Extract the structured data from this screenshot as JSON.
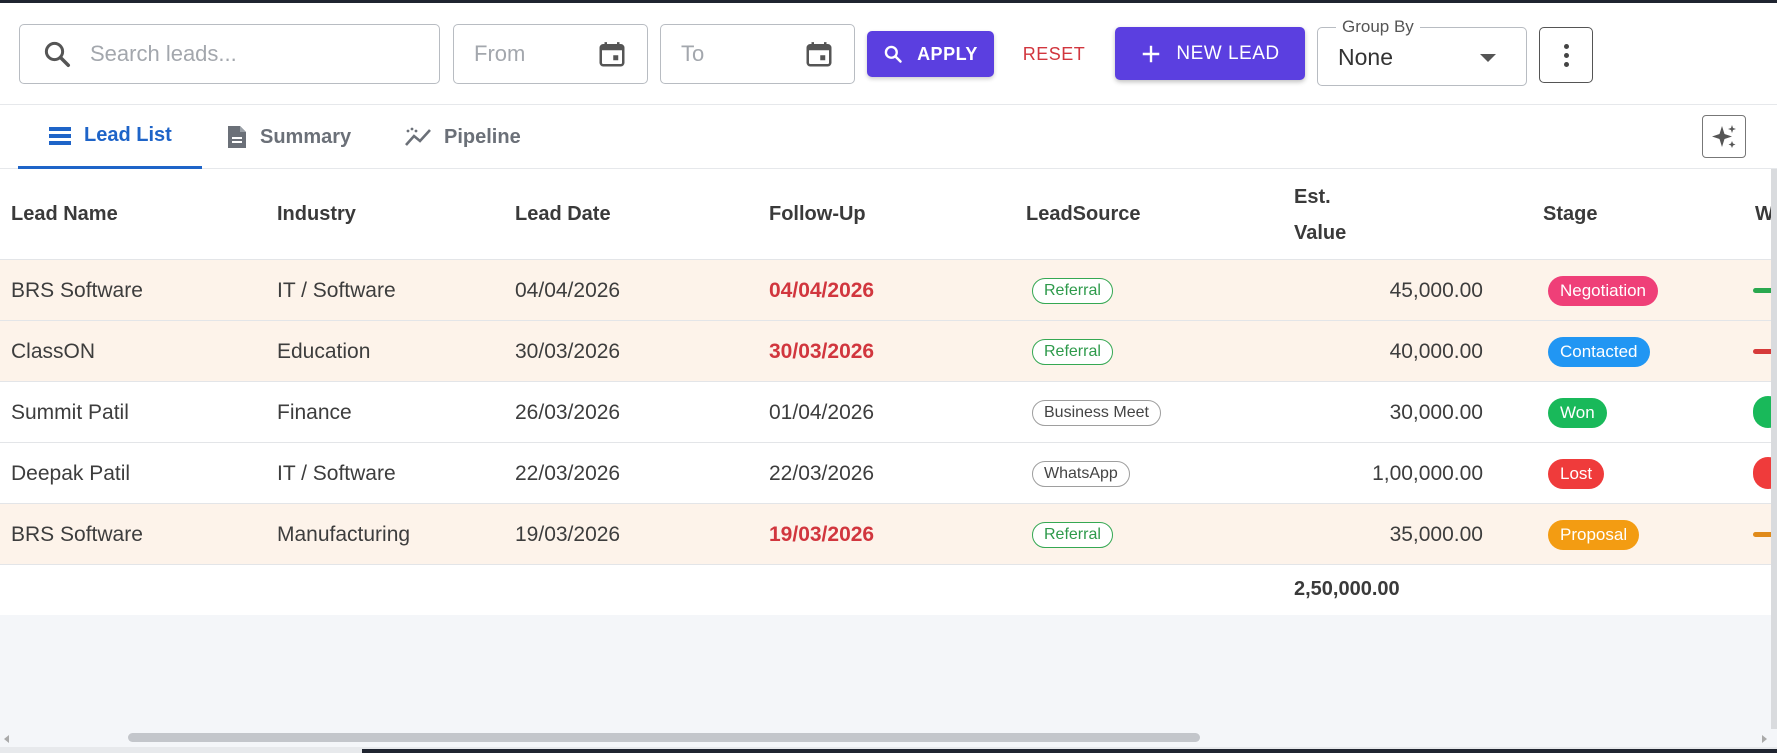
{
  "toolbar": {
    "search_placeholder": "Search leads...",
    "from_placeholder": "From",
    "to_placeholder": "To",
    "apply_label": "APPLY",
    "reset_label": "RESET",
    "new_lead_label": "NEW LEAD",
    "group_by_label": "Group By",
    "group_by_value": "None",
    "accent_color": "#5b3fe0"
  },
  "tabs": [
    {
      "label": "Lead List",
      "icon": "list-icon",
      "active": true
    },
    {
      "label": "Summary",
      "icon": "document-icon",
      "active": false
    },
    {
      "label": "Pipeline",
      "icon": "trend-icon",
      "active": false
    }
  ],
  "table": {
    "columns": {
      "lead_name": "Lead Name",
      "industry": "Industry",
      "lead_date": "Lead Date",
      "follow_up": "Follow-Up",
      "lead_source": "LeadSource",
      "est_value_1": "Est.",
      "est_value_2": "Value",
      "stage": "Stage",
      "w": "W"
    },
    "rows": [
      {
        "name": "BRS Software",
        "industry": "IT / Software",
        "lead_date": "04/04/2026",
        "follow_up": "04/04/2026",
        "overdue": true,
        "source": "Referral",
        "value": "45,000.00",
        "stage": "Negotiation",
        "stage_color": "#ef3f78",
        "edge_color": "#2aa84f",
        "highlight": true
      },
      {
        "name": "ClassON",
        "industry": "Education",
        "lead_date": "30/03/2026",
        "follow_up": "30/03/2026",
        "overdue": true,
        "source": "Referral",
        "value": "40,000.00",
        "stage": "Contacted",
        "stage_color": "#2196f3",
        "edge_color": "#d63a3a",
        "highlight": true
      },
      {
        "name": "Summit Patil",
        "industry": "Finance",
        "lead_date": "26/03/2026",
        "follow_up": "01/04/2026",
        "overdue": false,
        "source": "Business Meet",
        "value": "30,000.00",
        "stage": "Won",
        "stage_color": "#19b95a",
        "edge_color": "#19b95a",
        "highlight": false
      },
      {
        "name": "Deepak Patil",
        "industry": "IT / Software",
        "lead_date": "22/03/2026",
        "follow_up": "22/03/2026",
        "overdue": false,
        "source": "WhatsApp",
        "value": "1,00,000.00",
        "stage": "Lost",
        "stage_color": "#ef3b3b",
        "edge_color": "#ef3b3b",
        "highlight": false
      },
      {
        "name": "BRS Software",
        "industry": "Manufacturing",
        "lead_date": "19/03/2026",
        "follow_up": "19/03/2026",
        "overdue": true,
        "source": "Referral",
        "value": "35,000.00",
        "stage": "Proposal",
        "stage_color": "#f39c12",
        "edge_color": "#e08a1a",
        "highlight": true
      }
    ],
    "total_value": "2,50,000.00"
  }
}
